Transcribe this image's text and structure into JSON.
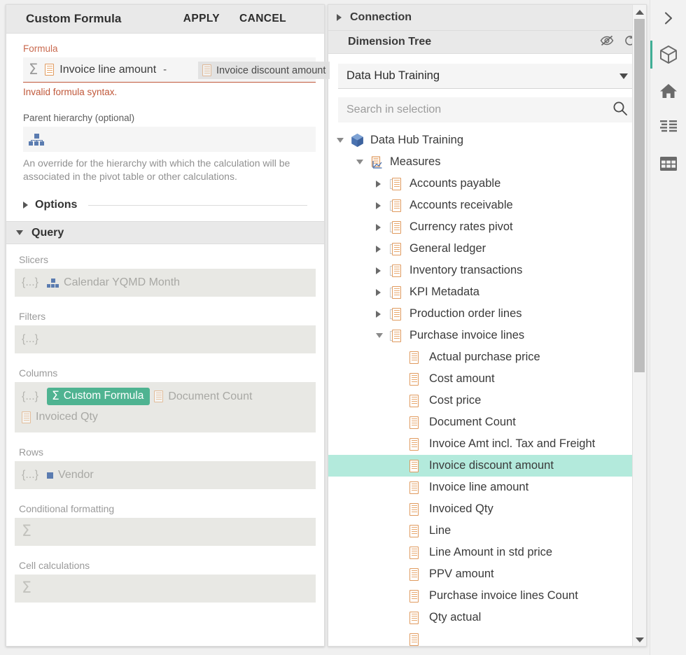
{
  "colors": {
    "accent_teal": "#4FB391",
    "selection_teal": "#B3EADC",
    "error_red": "#C0583A",
    "measure_orange": "#E09A5E",
    "hierarchy_blue": "#5B7CB0",
    "panel_header_grey": "#E9E9E9",
    "field_grey": "#E8E8E4"
  },
  "formula_panel": {
    "title": "Custom Formula",
    "apply_label": "APPLY",
    "cancel_label": "CANCEL",
    "formula": {
      "label": "Formula",
      "sigma_icon": "sigma-icon",
      "token1_icon": "measure-icon",
      "token1": "Invoice line amount",
      "operator": "-",
      "token2_icon": "measure-icon",
      "token2": "Invoice discount amount",
      "error": "Invalid formula syntax."
    },
    "parent_hierarchy": {
      "label": "Parent hierarchy (optional)",
      "icon": "hierarchy-icon",
      "value": "",
      "help": "An override for the hierarchy with which the calculation will be associated in the pivot table or other calculations."
    },
    "options": {
      "label": "Options",
      "expander_icon": "triangle-right-icon",
      "expanded": false
    },
    "query": {
      "label": "Query",
      "expander_icon": "triangle-down-icon",
      "expanded": true,
      "sections": [
        {
          "name": "slicers",
          "label": "Slicers",
          "braces": "{...}",
          "items": [
            {
              "icon": "hierarchy-icon",
              "label": "Calendar YQMD Month",
              "chip": false
            }
          ]
        },
        {
          "name": "filters",
          "label": "Filters",
          "braces": "{...}",
          "items": []
        },
        {
          "name": "columns",
          "label": "Columns",
          "braces": "{...}",
          "items": [
            {
              "icon": "sigma-icon",
              "label": "Custom Formula",
              "chip": true
            },
            {
              "icon": "measure-icon",
              "label": "Document Count",
              "chip": false
            },
            {
              "icon": "measure-icon",
              "label": "Invoiced Qty",
              "chip": false
            }
          ]
        },
        {
          "name": "rows",
          "label": "Rows",
          "braces": "{...}",
          "items": [
            {
              "icon": "square-icon",
              "label": "Vendor",
              "chip": false
            }
          ]
        },
        {
          "name": "conditional_formatting",
          "label": "Conditional formatting",
          "icon": "sigma-icon",
          "items": []
        },
        {
          "name": "cell_calculations",
          "label": "Cell calculations",
          "icon": "sigma-icon",
          "items": []
        }
      ]
    }
  },
  "drag_ghost": {
    "icon": "measure-icon",
    "label": "Invoice discount amount"
  },
  "dimension_panel": {
    "connection": {
      "label": "Connection",
      "expander_icon": "triangle-right-icon",
      "expanded": false
    },
    "dimension_tree": {
      "label": "Dimension Tree",
      "hide_icon": "eye-off-icon",
      "refresh_icon": "refresh-icon"
    },
    "cube_select": {
      "value": "Data Hub Training",
      "caret_icon": "chevron-down-icon"
    },
    "search": {
      "placeholder": "Search in selection",
      "value": "",
      "icon": "search-icon"
    },
    "scrollbar": {
      "up_icon": "scroll-up-arrow-icon",
      "down_icon": "scroll-down-arrow-icon"
    },
    "tree": [
      {
        "label": "Data Hub Training",
        "level": 1,
        "icon": "cube-icon",
        "state": "expanded",
        "selected": false
      },
      {
        "label": "Measures",
        "level": 2,
        "icon": "measures-axis-icon",
        "state": "expanded",
        "selected": false
      },
      {
        "label": "Accounts payable",
        "level": 3,
        "icon": "measure-folder-icon",
        "state": "collapsed",
        "selected": false
      },
      {
        "label": "Accounts receivable",
        "level": 3,
        "icon": "measure-folder-icon",
        "state": "collapsed",
        "selected": false
      },
      {
        "label": "Currency rates pivot",
        "level": 3,
        "icon": "measure-folder-icon",
        "state": "collapsed",
        "selected": false
      },
      {
        "label": "General ledger",
        "level": 3,
        "icon": "measure-folder-icon",
        "state": "collapsed",
        "selected": false
      },
      {
        "label": "Inventory transactions",
        "level": 3,
        "icon": "measure-folder-icon",
        "state": "collapsed",
        "selected": false
      },
      {
        "label": "KPI Metadata",
        "level": 3,
        "icon": "measure-folder-icon",
        "state": "collapsed",
        "selected": false
      },
      {
        "label": "Production order lines",
        "level": 3,
        "icon": "measure-folder-icon",
        "state": "collapsed",
        "selected": false
      },
      {
        "label": "Purchase invoice lines",
        "level": 3,
        "icon": "measure-folder-icon",
        "state": "expanded",
        "selected": false
      },
      {
        "label": "Actual purchase price",
        "level": 4,
        "icon": "measure-icon",
        "state": "leaf",
        "selected": false
      },
      {
        "label": "Cost amount",
        "level": 4,
        "icon": "measure-icon",
        "state": "leaf",
        "selected": false
      },
      {
        "label": "Cost price",
        "level": 4,
        "icon": "measure-icon",
        "state": "leaf",
        "selected": false
      },
      {
        "label": "Document Count",
        "level": 4,
        "icon": "measure-icon",
        "state": "leaf",
        "selected": false
      },
      {
        "label": "Invoice Amt incl. Tax and Freight",
        "level": 4,
        "icon": "measure-icon",
        "state": "leaf",
        "selected": false
      },
      {
        "label": "Invoice discount amount",
        "level": 4,
        "icon": "measure-icon",
        "state": "leaf",
        "selected": true
      },
      {
        "label": "Invoice line amount",
        "level": 4,
        "icon": "measure-icon",
        "state": "leaf",
        "selected": false
      },
      {
        "label": "Invoiced Qty",
        "level": 4,
        "icon": "measure-icon",
        "state": "leaf",
        "selected": false
      },
      {
        "label": "Line",
        "level": 4,
        "icon": "measure-icon",
        "state": "leaf",
        "selected": false
      },
      {
        "label": "Line Amount in std price",
        "level": 4,
        "icon": "measure-icon",
        "state": "leaf",
        "selected": false
      },
      {
        "label": "PPV amount",
        "level": 4,
        "icon": "measure-icon",
        "state": "leaf",
        "selected": false
      },
      {
        "label": "Purchase invoice lines Count",
        "level": 4,
        "icon": "measure-icon",
        "state": "leaf",
        "selected": false
      },
      {
        "label": "Qty actual",
        "level": 4,
        "icon": "measure-icon",
        "state": "leaf",
        "selected": false
      }
    ]
  },
  "right_rail": [
    {
      "name": "expand-panel",
      "icon": "chevron-right-icon",
      "active": false
    },
    {
      "name": "cube-view",
      "icon": "cube-icon",
      "active": true
    },
    {
      "name": "home-view",
      "icon": "home-icon",
      "active": false
    },
    {
      "name": "list-view",
      "icon": "list-icon",
      "active": false
    },
    {
      "name": "table-view",
      "icon": "table-grid-icon",
      "active": false
    }
  ]
}
